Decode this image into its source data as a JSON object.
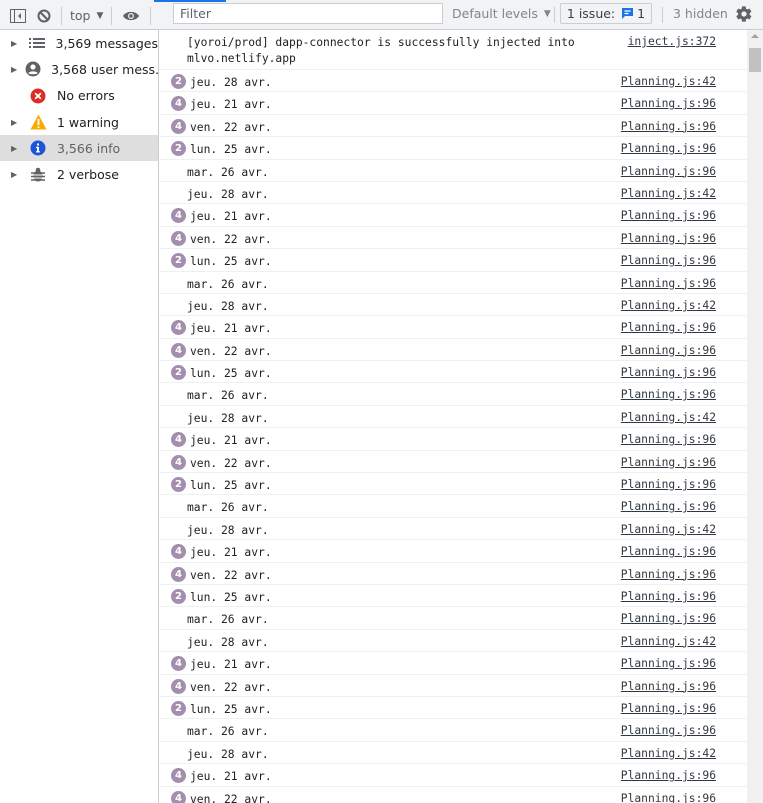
{
  "toolbar": {
    "context_label": "top",
    "filter_placeholder": "Filter",
    "filter_value": "",
    "levels_label": "Default levels",
    "issues_label": "1 issue:",
    "issues_count": "1",
    "hidden_label": "3 hidden",
    "icons": {
      "sidebar_toggle": "sidebar-toggle-icon",
      "clear": "clear-console-icon",
      "eye": "live-expression-eye-icon",
      "gear": "settings-gear-icon",
      "issue": "issue-message-icon"
    }
  },
  "sidebar": {
    "items": [
      {
        "label": "3,569 messages",
        "icon": "list-icon",
        "expandable": true,
        "selected": false
      },
      {
        "label": "3,568 user mess…",
        "icon": "user-icon",
        "expandable": true,
        "selected": false
      },
      {
        "label": "No errors",
        "icon": "error-icon",
        "expandable": false,
        "selected": false
      },
      {
        "label": "1 warning",
        "icon": "warning-icon",
        "expandable": true,
        "selected": false
      },
      {
        "label": "3,566 info",
        "icon": "info-icon",
        "expandable": true,
        "selected": true
      },
      {
        "label": "2 verbose",
        "icon": "bug-icon",
        "expandable": true,
        "selected": false
      }
    ]
  },
  "console": {
    "messages": [
      {
        "text": "[yoroi/prod] dapp-connector is successfully injected into\nmlvo.netlify.app",
        "source": "inject.js:372",
        "count": null
      },
      {
        "text": "jeu. 28 avr.",
        "source": "Planning.js:42",
        "count": "2"
      },
      {
        "text": "jeu. 21 avr.",
        "source": "Planning.js:96",
        "count": "4"
      },
      {
        "text": "ven. 22 avr.",
        "source": "Planning.js:96",
        "count": "4"
      },
      {
        "text": "lun. 25 avr.",
        "source": "Planning.js:96",
        "count": "2"
      },
      {
        "text": "mar. 26 avr.",
        "source": "Planning.js:96",
        "count": null
      },
      {
        "text": "jeu. 28 avr.",
        "source": "Planning.js:42",
        "count": null
      },
      {
        "text": "jeu. 21 avr.",
        "source": "Planning.js:96",
        "count": "4"
      },
      {
        "text": "ven. 22 avr.",
        "source": "Planning.js:96",
        "count": "4"
      },
      {
        "text": "lun. 25 avr.",
        "source": "Planning.js:96",
        "count": "2"
      },
      {
        "text": "mar. 26 avr.",
        "source": "Planning.js:96",
        "count": null
      },
      {
        "text": "jeu. 28 avr.",
        "source": "Planning.js:42",
        "count": null
      },
      {
        "text": "jeu. 21 avr.",
        "source": "Planning.js:96",
        "count": "4"
      },
      {
        "text": "ven. 22 avr.",
        "source": "Planning.js:96",
        "count": "4"
      },
      {
        "text": "lun. 25 avr.",
        "source": "Planning.js:96",
        "count": "2"
      },
      {
        "text": "mar. 26 avr.",
        "source": "Planning.js:96",
        "count": null
      },
      {
        "text": "jeu. 28 avr.",
        "source": "Planning.js:42",
        "count": null
      },
      {
        "text": "jeu. 21 avr.",
        "source": "Planning.js:96",
        "count": "4"
      },
      {
        "text": "ven. 22 avr.",
        "source": "Planning.js:96",
        "count": "4"
      },
      {
        "text": "lun. 25 avr.",
        "source": "Planning.js:96",
        "count": "2"
      },
      {
        "text": "mar. 26 avr.",
        "source": "Planning.js:96",
        "count": null
      },
      {
        "text": "jeu. 28 avr.",
        "source": "Planning.js:42",
        "count": null
      },
      {
        "text": "jeu. 21 avr.",
        "source": "Planning.js:96",
        "count": "4"
      },
      {
        "text": "ven. 22 avr.",
        "source": "Planning.js:96",
        "count": "4"
      },
      {
        "text": "lun. 25 avr.",
        "source": "Planning.js:96",
        "count": "2"
      },
      {
        "text": "mar. 26 avr.",
        "source": "Planning.js:96",
        "count": null
      },
      {
        "text": "jeu. 28 avr.",
        "source": "Planning.js:42",
        "count": null
      },
      {
        "text": "jeu. 21 avr.",
        "source": "Planning.js:96",
        "count": "4"
      },
      {
        "text": "ven. 22 avr.",
        "source": "Planning.js:96",
        "count": "4"
      },
      {
        "text": "lun. 25 avr.",
        "source": "Planning.js:96",
        "count": "2"
      },
      {
        "text": "mar. 26 avr.",
        "source": "Planning.js:96",
        "count": null
      },
      {
        "text": "jeu. 28 avr.",
        "source": "Planning.js:42",
        "count": null
      },
      {
        "text": "jeu. 21 avr.",
        "source": "Planning.js:96",
        "count": "4"
      },
      {
        "text": "ven. 22 avr.",
        "source": "Planning.js:96",
        "count": "4"
      }
    ]
  },
  "colors": {
    "accent": "#1a73e8",
    "badge": "#a38fad",
    "error": "#d93025",
    "warning": "#f9ab00",
    "info": "#1a56db",
    "selected_bg": "#dedede"
  }
}
